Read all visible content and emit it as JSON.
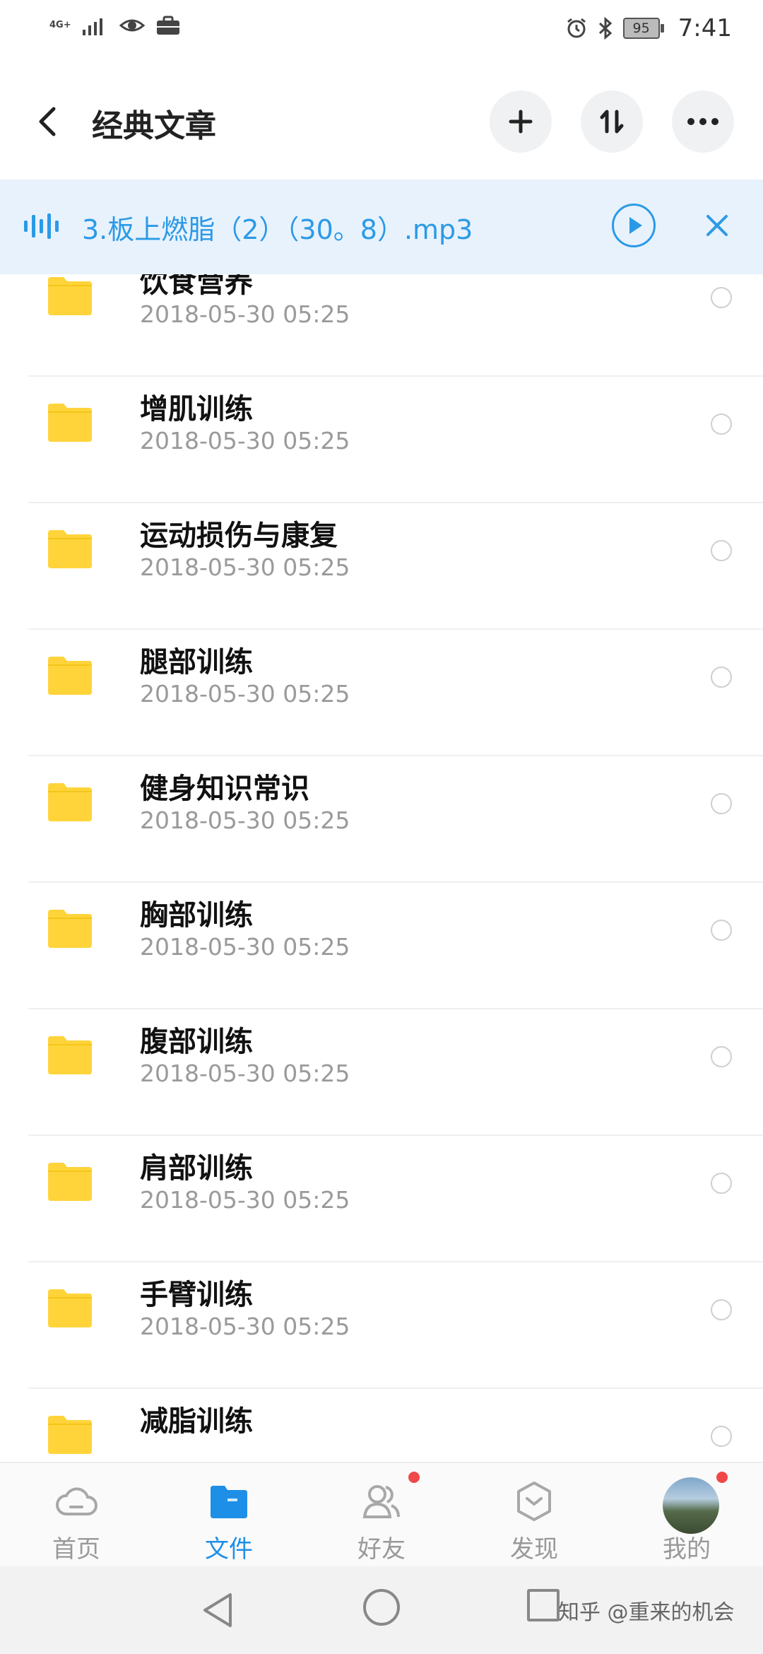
{
  "status_bar": {
    "network": "4G+",
    "battery": "95",
    "time": "7:41"
  },
  "header": {
    "title": "经典文章"
  },
  "player": {
    "track": "3.板上燃脂（2）（30。8）.mp3"
  },
  "files": [
    {
      "name": "饮食营养",
      "date": "2018-05-30  05:25"
    },
    {
      "name": "增肌训练",
      "date": "2018-05-30  05:25"
    },
    {
      "name": "运动损伤与康复",
      "date": "2018-05-30  05:25"
    },
    {
      "name": "腿部训练",
      "date": "2018-05-30  05:25"
    },
    {
      "name": "健身知识常识",
      "date": "2018-05-30  05:25"
    },
    {
      "name": "胸部训练",
      "date": "2018-05-30  05:25"
    },
    {
      "name": "腹部训练",
      "date": "2018-05-30  05:25"
    },
    {
      "name": "肩部训练",
      "date": "2018-05-30  05:25"
    },
    {
      "name": "手臂训练",
      "date": "2018-05-30  05:25"
    },
    {
      "name": "减脂训练",
      "date": ""
    }
  ],
  "tabs": [
    {
      "label": "首页",
      "icon": "cloud-icon"
    },
    {
      "label": "文件",
      "icon": "folder-icon"
    },
    {
      "label": "好友",
      "icon": "friends-icon"
    },
    {
      "label": "发现",
      "icon": "discover-icon"
    },
    {
      "label": "我的",
      "icon": "avatar"
    }
  ],
  "watermark": "知乎 @重来的机会",
  "colors": {
    "accent": "#1d8fe6",
    "player_bg": "#e8f2fd",
    "folder": "#ffd43b",
    "badge": "#f04848"
  }
}
